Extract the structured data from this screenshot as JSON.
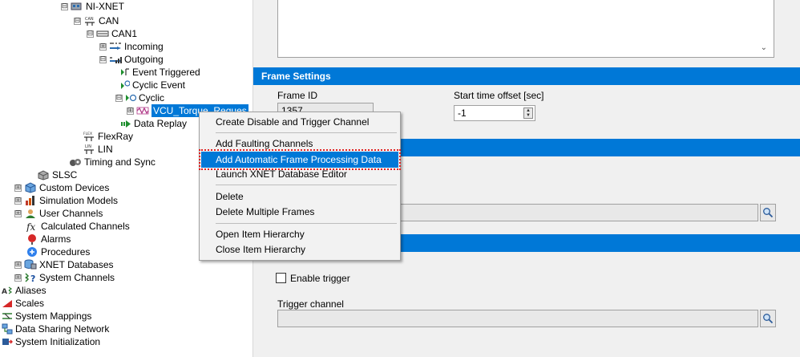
{
  "tree": {
    "items": [
      {
        "id": "ni-xnet",
        "label": "NI-XNET",
        "icon": "ni-xnet-icon",
        "expander": "⊟"
      },
      {
        "id": "can",
        "label": "CAN",
        "icon": "can-network-icon",
        "expander": "⊟"
      },
      {
        "id": "can1",
        "label": "CAN1",
        "icon": "can-port-icon",
        "expander": "⊟"
      },
      {
        "id": "incoming",
        "label": "Incoming",
        "icon": "incoming-icon",
        "expander": "⊞"
      },
      {
        "id": "outgoing",
        "label": "Outgoing",
        "icon": "outgoing-icon",
        "expander": "⊟"
      },
      {
        "id": "event-triggered",
        "label": "Event Triggered",
        "icon": "event-triggered-icon",
        "expander": ""
      },
      {
        "id": "cyclic-event",
        "label": "Cyclic Event",
        "icon": "cyclic-event-icon",
        "expander": ""
      },
      {
        "id": "cyclic",
        "label": "Cyclic",
        "icon": "cyclic-icon",
        "expander": "⊟"
      },
      {
        "id": "vcu-torque-request",
        "label": "VCU_Torque_Reques",
        "icon": "frame-icon",
        "expander": "⊞"
      },
      {
        "id": "data-replay",
        "label": "Data Replay",
        "icon": "data-replay-icon",
        "expander": ""
      },
      {
        "id": "flexray",
        "label": "FlexRay",
        "icon": "flexray-icon",
        "expander": ""
      },
      {
        "id": "lin",
        "label": "LIN",
        "icon": "lin-icon",
        "expander": ""
      },
      {
        "id": "timing-and-sync",
        "label": "Timing and Sync",
        "icon": "timing-sync-icon",
        "expander": ""
      },
      {
        "id": "slsc",
        "label": "SLSC",
        "icon": "slsc-icon",
        "expander": ""
      },
      {
        "id": "custom-devices",
        "label": "Custom Devices",
        "icon": "custom-devices-icon",
        "expander": "⊞"
      },
      {
        "id": "simulation-models",
        "label": "Simulation Models",
        "icon": "simulation-models-icon",
        "expander": "⊞"
      },
      {
        "id": "user-channels",
        "label": "User Channels",
        "icon": "user-channels-icon",
        "expander": "⊞"
      },
      {
        "id": "calculated-channels",
        "label": "Calculated Channels",
        "icon": "calculated-channels-icon",
        "expander": ""
      },
      {
        "id": "alarms",
        "label": "Alarms",
        "icon": "alarms-icon",
        "expander": ""
      },
      {
        "id": "procedures",
        "label": "Procedures",
        "icon": "procedures-icon",
        "expander": ""
      },
      {
        "id": "xnet-databases",
        "label": "XNET Databases",
        "icon": "xnet-databases-icon",
        "expander": "⊞"
      },
      {
        "id": "system-channels",
        "label": "System Channels",
        "icon": "system-channels-icon",
        "expander": "⊞"
      },
      {
        "id": "aliases",
        "label": "Aliases",
        "icon": "aliases-icon",
        "expander": ""
      },
      {
        "id": "scales",
        "label": "Scales",
        "icon": "scales-icon",
        "expander": ""
      },
      {
        "id": "system-mappings",
        "label": "System Mappings",
        "icon": "system-mappings-icon",
        "expander": ""
      },
      {
        "id": "data-sharing-network",
        "label": "Data Sharing Network",
        "icon": "data-sharing-network-icon",
        "expander": ""
      },
      {
        "id": "system-initialization",
        "label": "System Initialization",
        "icon": "system-initialization-icon",
        "expander": ""
      }
    ]
  },
  "right_panel": {
    "frame_settings_title": "Frame Settings",
    "frame_id_label": "Frame ID",
    "frame_id_value": "1357",
    "start_time_offset_label": "Start time offset [sec]",
    "start_time_offset_value": "-1",
    "enable_trigger_label": "Enable trigger",
    "trigger_channel_label": "Trigger channel"
  },
  "context_menu": {
    "items": [
      "Create Disable and Trigger Channel",
      "Add Faulting Channels",
      "Add Automatic Frame Processing Data",
      "Launch XNET Database Editor",
      "Delete",
      "Delete Multiple Frames",
      "Open Item Hierarchy",
      "Close Item Hierarchy"
    ],
    "highlighted_index": 2
  },
  "colors": {
    "section_bar": "#0078d7",
    "selection": "#0078d7",
    "highlight_outline": "#e02020"
  }
}
